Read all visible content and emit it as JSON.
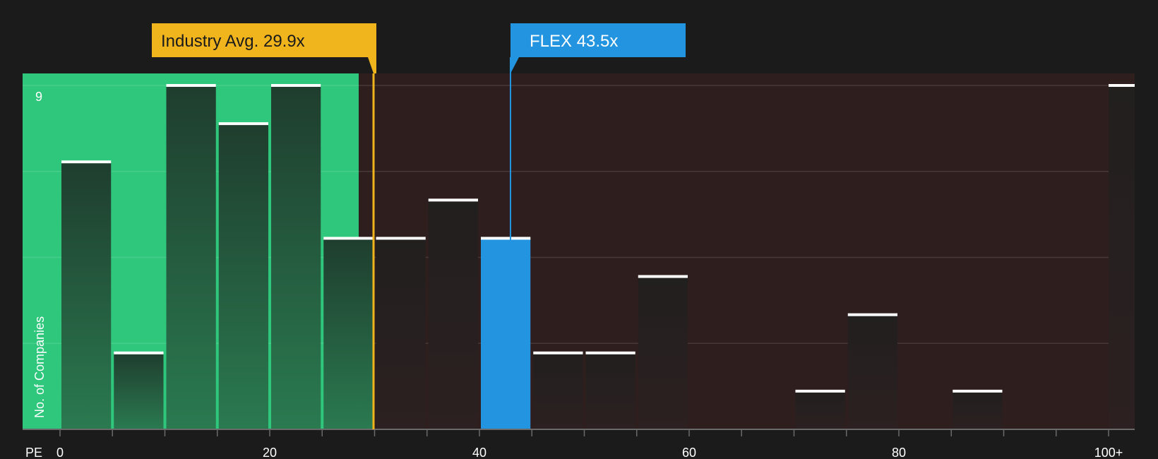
{
  "chart_data": {
    "type": "bar",
    "x_axis_label": "PE",
    "y_axis_label": "No. of Companies",
    "x_ticks": [
      "0",
      "20",
      "40",
      "60",
      "80",
      "100+"
    ],
    "y_tick_top": "9",
    "ylim": [
      0,
      9.3
    ],
    "bin_width": 5,
    "bars": [
      {
        "x": 0,
        "value": 7
      },
      {
        "x": 5,
        "value": 2
      },
      {
        "x": 10,
        "value": 9
      },
      {
        "x": 15,
        "value": 8
      },
      {
        "x": 20,
        "value": 9
      },
      {
        "x": 25,
        "value": 5
      },
      {
        "x": 30,
        "value": 5
      },
      {
        "x": 35,
        "value": 6
      },
      {
        "x": 40,
        "value": 5
      },
      {
        "x": 45,
        "value": 2
      },
      {
        "x": 50,
        "value": 2
      },
      {
        "x": 55,
        "value": 4
      },
      {
        "x": 70,
        "value": 1
      },
      {
        "x": 75,
        "value": 3
      },
      {
        "x": 85,
        "value": 1
      },
      {
        "x": 100,
        "value": 9
      }
    ],
    "industry_avg": {
      "label": "Industry Avg. 29.9x",
      "value": 29.9,
      "color": "#f0b41c"
    },
    "company": {
      "label": "FLEX 43.5x",
      "value": 43.5,
      "color": "#2394e0"
    },
    "colors": {
      "below_avg_bg": "#2ec77c",
      "above_avg_bg": "#2f1e1e",
      "bar_below": "#245a3c",
      "bar_above": "#242020"
    }
  }
}
